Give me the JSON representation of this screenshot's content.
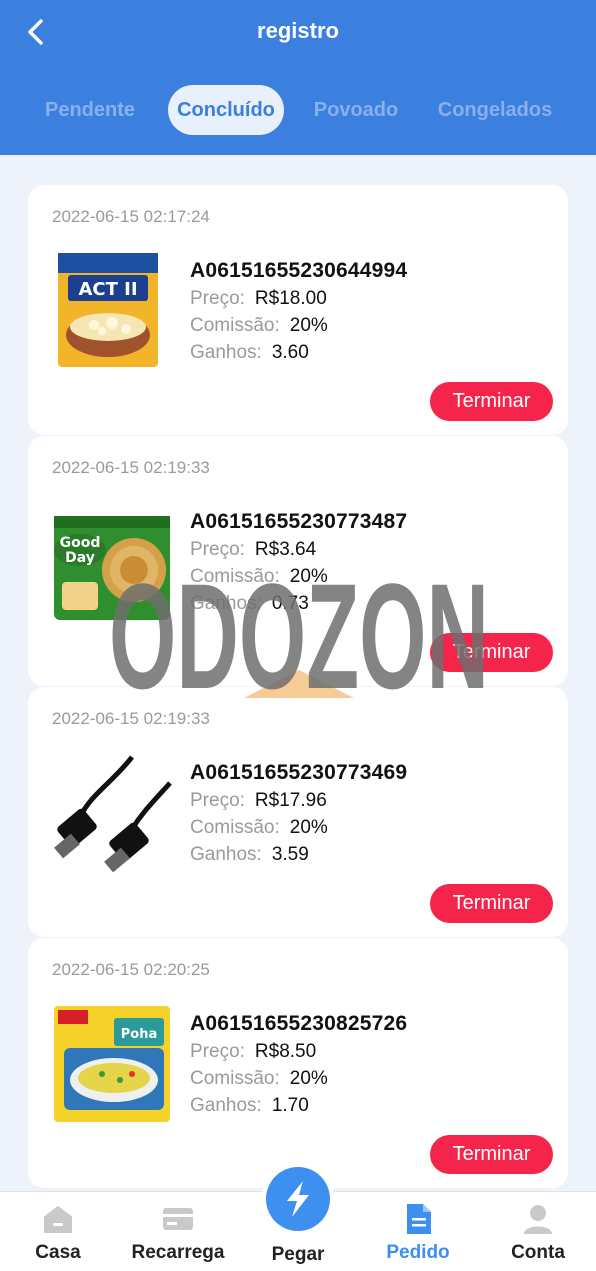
{
  "header": {
    "title": "registro",
    "tabs": [
      {
        "label": "Pendente"
      },
      {
        "label": "Concluído"
      },
      {
        "label": "Povoado"
      },
      {
        "label": "Congelados"
      }
    ],
    "active_tab": "Concluído"
  },
  "labels": {
    "price": "Preço:",
    "commission": "Comissão:",
    "earnings": "Ganhos:",
    "finish": "Terminar"
  },
  "orders": [
    {
      "date": "2022-06-15 02:17:24",
      "id": "A06151655230644994",
      "price": "R$18.00",
      "commission": "20%",
      "earnings": "3.60",
      "product_icon": "popcorn-package"
    },
    {
      "date": "2022-06-15 02:19:33",
      "id": "A06151655230773487",
      "price": "R$3.64",
      "commission": "20%",
      "earnings": "0.73",
      "product_icon": "biscuit-package"
    },
    {
      "date": "2022-06-15 02:19:33",
      "id": "A06151655230773469",
      "price": "R$17.96",
      "commission": "20%",
      "earnings": "3.59",
      "product_icon": "hdmi-cable"
    },
    {
      "date": "2022-06-15 02:20:25",
      "id": "A06151655230825726",
      "price": "R$8.50",
      "commission": "20%",
      "earnings": "1.70",
      "product_icon": "noodle-package"
    }
  ],
  "watermark": "ODOZON",
  "nav": {
    "items": [
      {
        "label": "Casa",
        "icon": "home-icon"
      },
      {
        "label": "Recarrega",
        "icon": "card-icon"
      },
      {
        "label": "Pegar",
        "icon": "lightning-icon"
      },
      {
        "label": "Pedido",
        "icon": "document-icon"
      },
      {
        "label": "Conta",
        "icon": "user-icon"
      }
    ],
    "active": "Pedido"
  },
  "colors": {
    "header": "#3b7fdf",
    "accent": "#3d8ff0",
    "button": "#f5244a",
    "background": "#eef3fb"
  }
}
